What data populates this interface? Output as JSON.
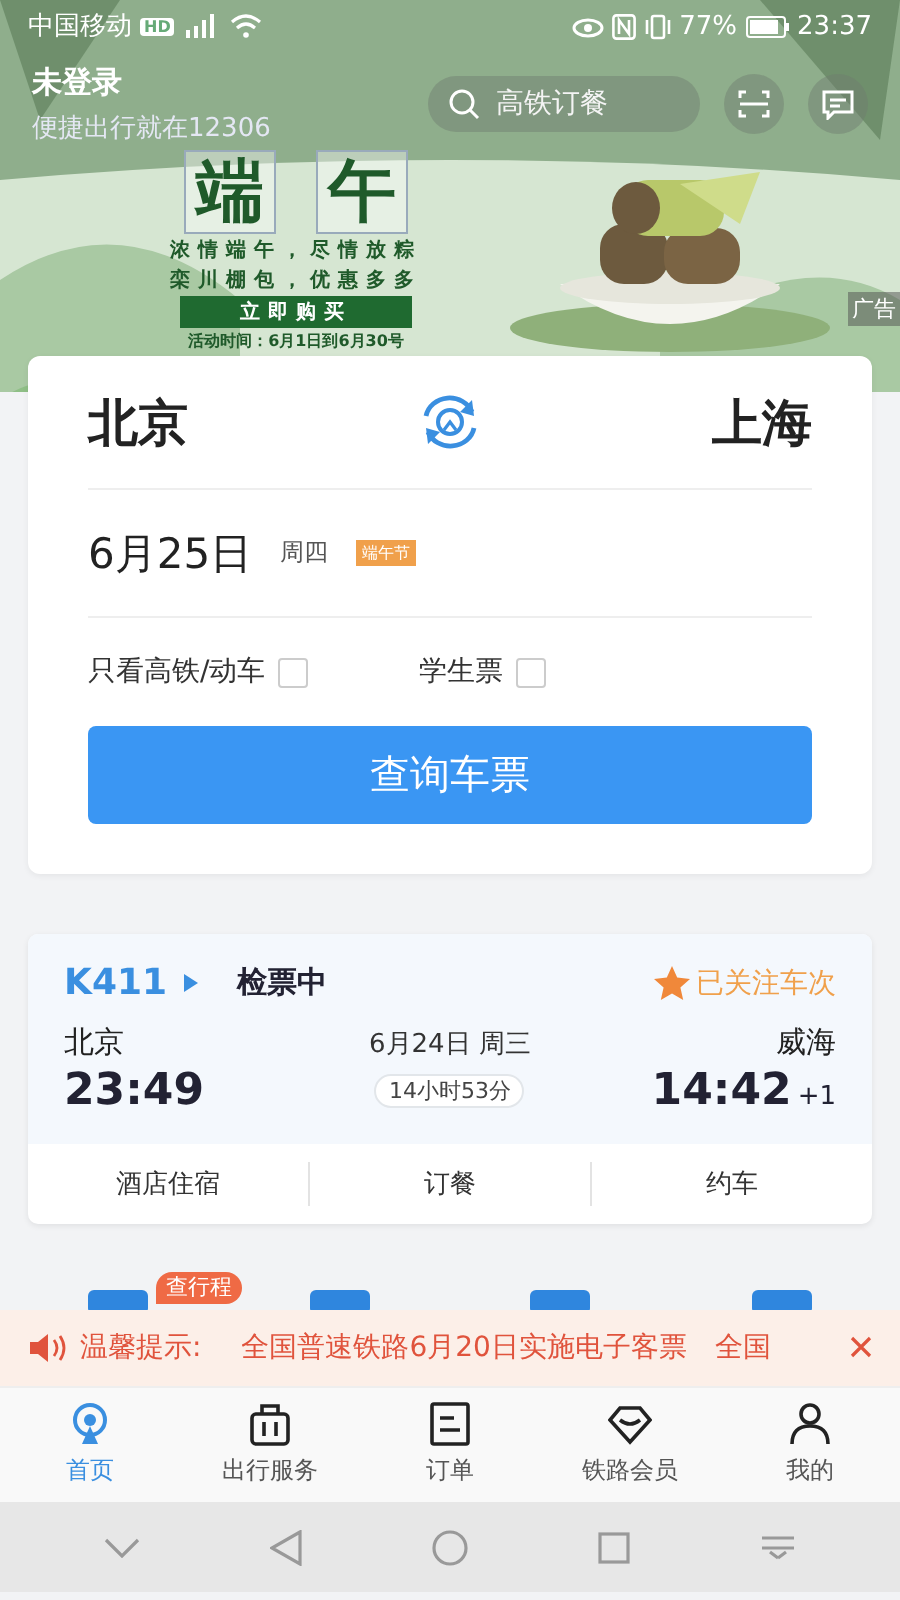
{
  "status_bar": {
    "carrier": "中国移动",
    "network_badge": "HD",
    "battery_percent": "77%",
    "time": "23:37"
  },
  "header": {
    "title": "未登录",
    "subtitle": "便捷出行就在12306",
    "search": {
      "placeholder": "高铁订餐"
    }
  },
  "banner": {
    "title_chars": [
      "端",
      "午"
    ],
    "lines": [
      "浓情端午，尽情放粽",
      "栾川棚包，优惠多多"
    ],
    "button": "立即购买",
    "period": "活动时间：6月1日到6月30号",
    "ad_label": "广告"
  },
  "search_card": {
    "from": "北京",
    "to": "上海",
    "date": "6月25日",
    "weekday": "周四",
    "holiday": "端午节",
    "options": [
      {
        "label": "只看高铁/动车",
        "checked": false
      },
      {
        "label": "学生票",
        "checked": false
      }
    ],
    "button": "查询车票"
  },
  "trip": {
    "train": "K411",
    "status": "检票中",
    "follow": "已关注车次",
    "depart_station": "北京",
    "depart_time": "23:49",
    "date": "6月24日 周三",
    "duration": "14小时53分",
    "arrive_station": "威海",
    "arrive_time": "14:42",
    "day_offset": "+1",
    "actions": [
      "酒店住宿",
      "订餐",
      "约车"
    ]
  },
  "services": {
    "badge": "查行程"
  },
  "notice": {
    "label": "温馨提示:",
    "messages": [
      "全国普速铁路6月20日实施电子客票",
      "全国"
    ]
  },
  "tabs": [
    {
      "label": "首页",
      "selected": true
    },
    {
      "label": "出行服务",
      "selected": false
    },
    {
      "label": "订单",
      "selected": false
    },
    {
      "label": "铁路会员",
      "selected": false
    },
    {
      "label": "我的",
      "selected": false
    }
  ]
}
